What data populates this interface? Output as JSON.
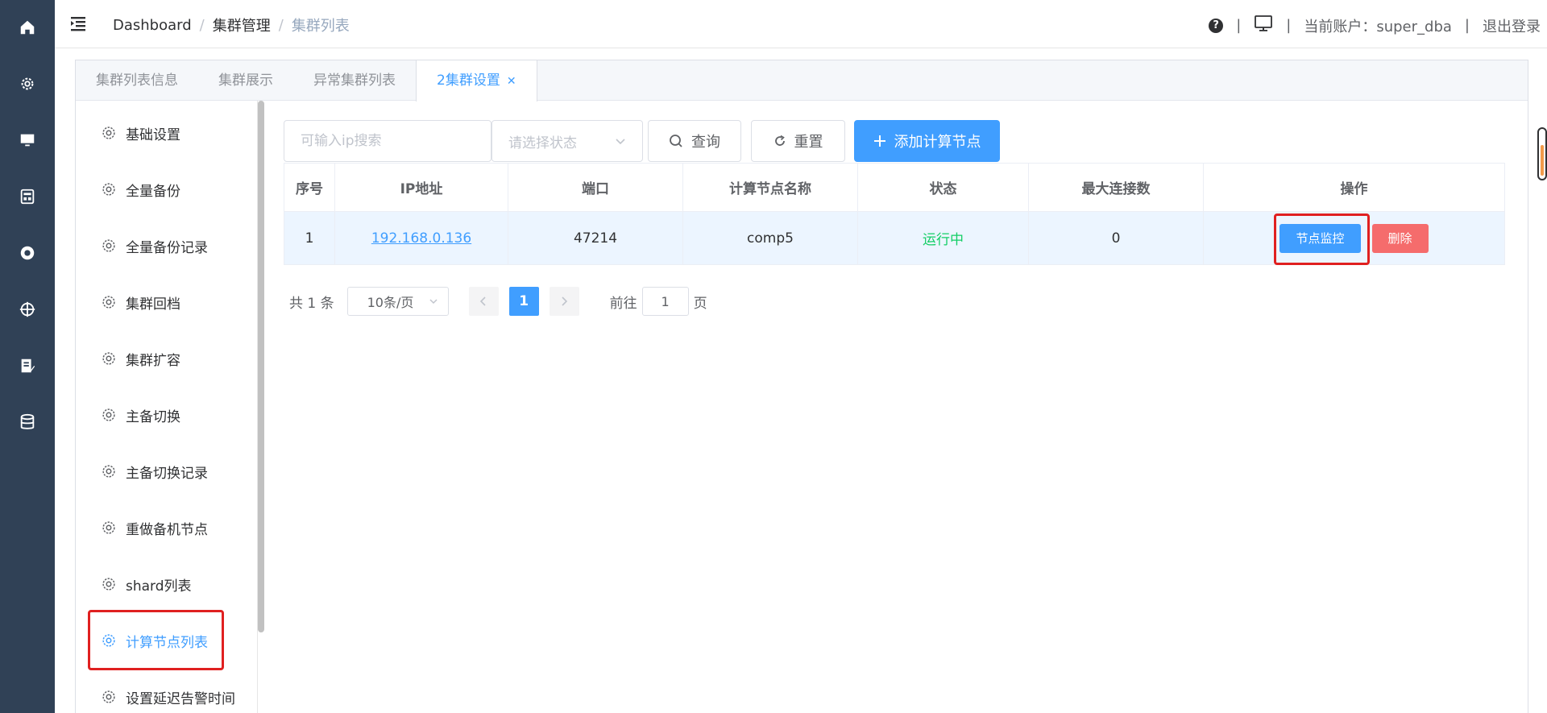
{
  "header": {
    "breadcrumb": [
      "Dashboard",
      "集群管理",
      "集群列表"
    ],
    "account_label": "当前账户：super_dba",
    "logout_label": "退出登录",
    "separator": "|"
  },
  "tabs": [
    {
      "label": "集群列表信息",
      "active": false
    },
    {
      "label": "集群展示",
      "active": false
    },
    {
      "label": "异常集群列表",
      "active": false
    },
    {
      "label": "2集群设置",
      "active": true
    }
  ],
  "sidebar_menu": [
    {
      "label": "基础设置"
    },
    {
      "label": "全量备份"
    },
    {
      "label": "全量备份记录"
    },
    {
      "label": "集群回档"
    },
    {
      "label": "集群扩容"
    },
    {
      "label": "主备切换"
    },
    {
      "label": "主备切换记录"
    },
    {
      "label": "重做备机节点"
    },
    {
      "label": "shard列表"
    },
    {
      "label": "计算节点列表",
      "active": true
    },
    {
      "label": "设置延迟告警时间"
    }
  ],
  "toolbar": {
    "search_placeholder": "可输入ip搜索",
    "status_placeholder": "请选择状态",
    "query_label": "查询",
    "reset_label": "重置",
    "add_label": "添加计算节点"
  },
  "table": {
    "columns": [
      "序号",
      "IP地址",
      "端口",
      "计算节点名称",
      "状态",
      "最大连接数",
      "操作"
    ],
    "rows": [
      {
        "index": "1",
        "ip": "192.168.0.136",
        "port": "47214",
        "name": "comp5",
        "status": "运行中",
        "max_conn": "0",
        "monitor_label": "节点监控",
        "delete_label": "删除"
      }
    ]
  },
  "pagination": {
    "total_label": "共 1 条",
    "page_size": "10条/页",
    "current_page": "1",
    "goto_label": "前往",
    "goto_value": "1",
    "page_suffix": "页"
  },
  "colors": {
    "accent": "#409eff",
    "danger": "#f56c6c",
    "success": "#13ce66",
    "rail": "#304156",
    "highlight": "#e02020"
  }
}
